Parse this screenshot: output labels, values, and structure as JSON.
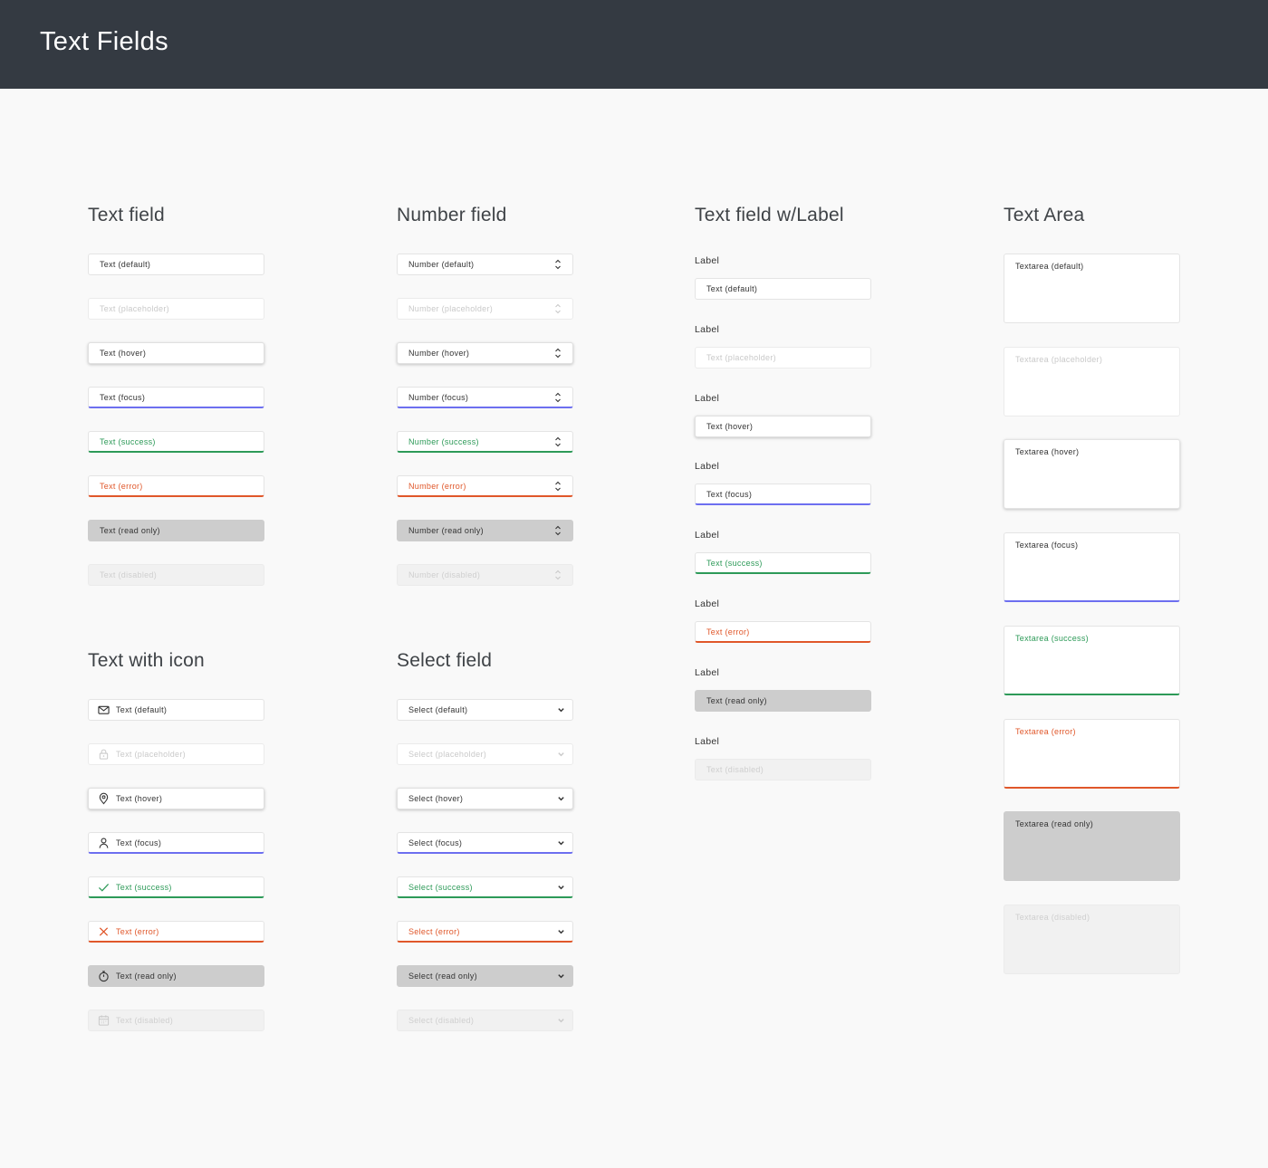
{
  "page": {
    "title": "Text Fields"
  },
  "colors": {
    "header_bg": "#343a42",
    "focus": "#6d6ff0",
    "success": "#2d9a58",
    "error": "#e0572a",
    "readonly": "#cdcdcd",
    "disabled": "#f1f1f1"
  },
  "text_field": {
    "title": "Text field",
    "items": [
      "Text (default)",
      "Text (placeholder)",
      "Text (hover)",
      "Text (focus)",
      "Text (success)",
      "Text (error)",
      "Text (read only)",
      "Text (disabled)"
    ]
  },
  "number_field": {
    "title": "Number field",
    "items": [
      "Number (default)",
      "Number (placeholder)",
      "Number (hover)",
      "Number (focus)",
      "Number (success)",
      "Number (error)",
      "Number (read only)",
      "Number (disabled)"
    ]
  },
  "labeled_field": {
    "title": "Text field w/Label",
    "label": "Label",
    "items": [
      "Text (default)",
      "Text (placeholder)",
      "Text (hover)",
      "Text (focus)",
      "Text (success)",
      "Text (error)",
      "Text (read only)",
      "Text (disabled)"
    ]
  },
  "text_area": {
    "title": "Text Area",
    "items": [
      "Textarea (default)",
      "Textarea (placeholder)",
      "Textarea (hover)",
      "Textarea (focus)",
      "Textarea (success)",
      "Textarea (error)",
      "Textarea (read only)",
      "Textarea (disabled)"
    ]
  },
  "icon_field": {
    "title": "Text with icon",
    "items": [
      "Text (default)",
      "Text (placeholder)",
      "Text (hover)",
      "Text (focus)",
      "Text (success)",
      "Text (error)",
      "Text (read only)",
      "Text (disabled)"
    ],
    "icons": [
      "envelope-icon",
      "lock-icon",
      "map-pin-icon",
      "user-icon",
      "checkmark-icon",
      "x-icon",
      "stopwatch-icon",
      "calendar-icon"
    ]
  },
  "select_field": {
    "title": "Select field",
    "items": [
      "Select (default)",
      "Select (placeholder)",
      "Select (hover)",
      "Select (focus)",
      "Select (success)",
      "Select (error)",
      "Select (read only)",
      "Select (disabled)"
    ]
  }
}
